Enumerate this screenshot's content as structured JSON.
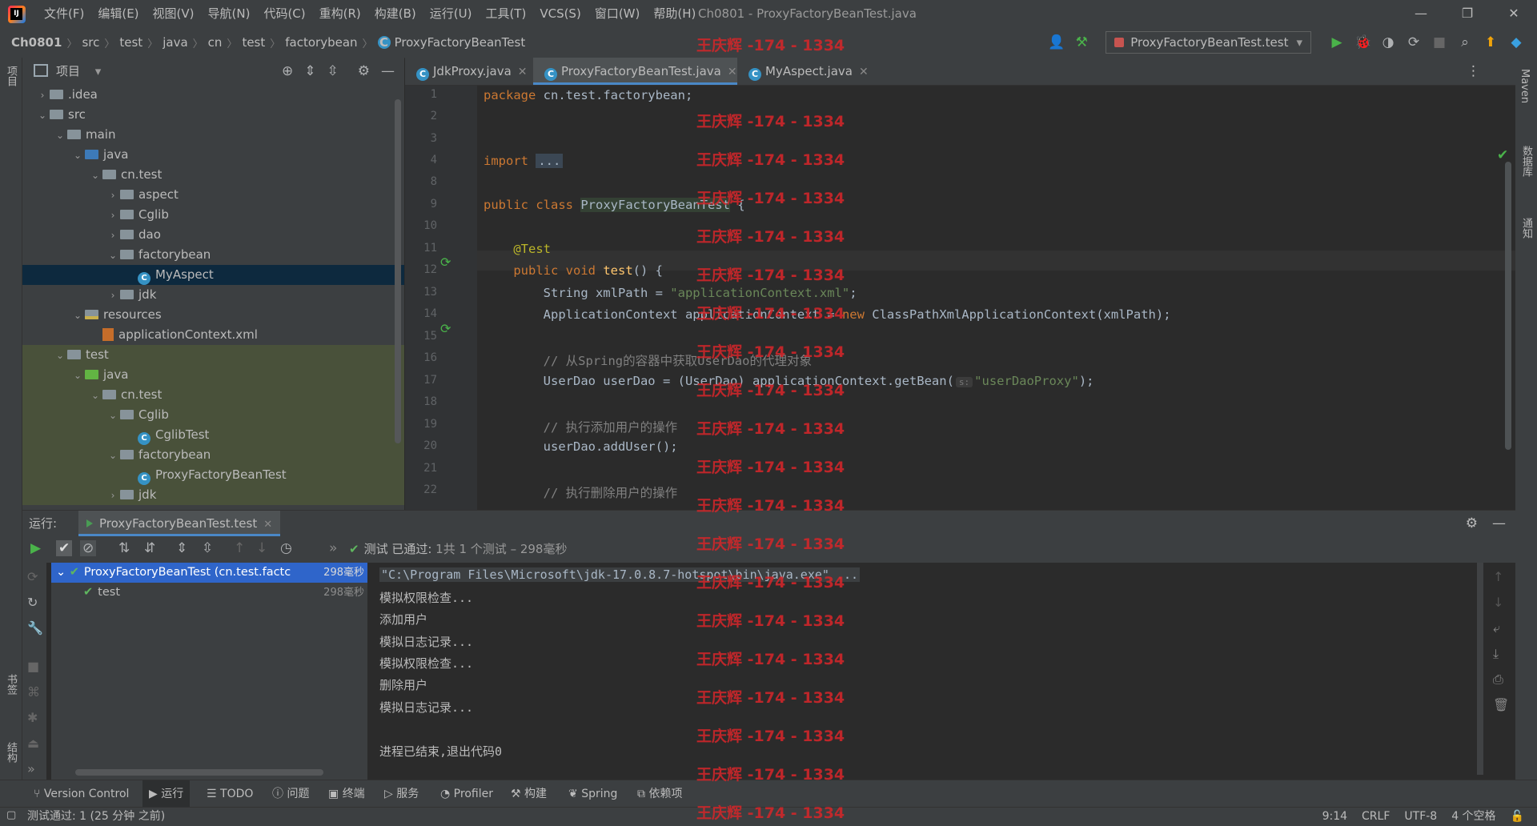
{
  "menubar": {
    "items": [
      "文件(F)",
      "编辑(E)",
      "视图(V)",
      "导航(N)",
      "代码(C)",
      "重构(R)",
      "构建(B)",
      "运行(U)",
      "工具(T)",
      "VCS(S)",
      "窗口(W)",
      "帮助(H)"
    ],
    "window_title": "Ch0801 - ProxyFactoryBeanTest.java"
  },
  "navbar": {
    "crumbs": [
      "Ch0801",
      "src",
      "test",
      "java",
      "cn",
      "test",
      "factorybean",
      "ProxyFactoryBeanTest"
    ],
    "run_config": "ProxyFactoryBeanTest.test"
  },
  "left_strip": {
    "project": "项目",
    "bookmarks": "书签",
    "structure": "结构"
  },
  "right_strip": {
    "maven": "Maven",
    "database": "数据库",
    "notifications": "通知"
  },
  "project": {
    "title": "项目",
    "tree": [
      {
        "label": ".idea",
        "depth": 0,
        "arrow": "right",
        "icon": "folder"
      },
      {
        "label": "src",
        "depth": 0,
        "arrow": "down",
        "icon": "folder"
      },
      {
        "label": "main",
        "depth": 1,
        "arrow": "down",
        "icon": "folder"
      },
      {
        "label": "java",
        "depth": 2,
        "arrow": "down",
        "icon": "folder-source"
      },
      {
        "label": "cn.test",
        "depth": 3,
        "arrow": "down",
        "icon": "package"
      },
      {
        "label": "aspect",
        "depth": 4,
        "arrow": "right",
        "icon": "package"
      },
      {
        "label": "Cglib",
        "depth": 4,
        "arrow": "right",
        "icon": "package"
      },
      {
        "label": "dao",
        "depth": 4,
        "arrow": "right",
        "icon": "package"
      },
      {
        "label": "factorybean",
        "depth": 4,
        "arrow": "down",
        "icon": "package"
      },
      {
        "label": "MyAspect",
        "depth": 5,
        "arrow": "",
        "icon": "class",
        "selected": true
      },
      {
        "label": "jdk",
        "depth": 4,
        "arrow": "right",
        "icon": "package"
      },
      {
        "label": "resources",
        "depth": 2,
        "arrow": "down",
        "icon": "folder-resources"
      },
      {
        "label": "applicationContext.xml",
        "depth": 3,
        "arrow": "",
        "icon": "xml"
      },
      {
        "label": "test",
        "depth": 1,
        "arrow": "down",
        "icon": "folder",
        "test": true
      },
      {
        "label": "java",
        "depth": 2,
        "arrow": "down",
        "icon": "folder-test",
        "test": true
      },
      {
        "label": "cn.test",
        "depth": 3,
        "arrow": "down",
        "icon": "package",
        "test": true
      },
      {
        "label": "Cglib",
        "depth": 4,
        "arrow": "down",
        "icon": "package",
        "test": true
      },
      {
        "label": "CglibTest",
        "depth": 5,
        "arrow": "",
        "icon": "class",
        "test": true
      },
      {
        "label": "factorybean",
        "depth": 4,
        "arrow": "down",
        "icon": "package",
        "test": true
      },
      {
        "label": "ProxyFactoryBeanTest",
        "depth": 5,
        "arrow": "",
        "icon": "class",
        "test": true
      },
      {
        "label": "jdk",
        "depth": 4,
        "arrow": "right",
        "icon": "package",
        "test": true
      }
    ]
  },
  "editor": {
    "tabs": [
      {
        "label": "JdkProxy.java",
        "active": false
      },
      {
        "label": "ProxyFactoryBeanTest.java",
        "active": true
      },
      {
        "label": "MyAspect.java",
        "active": false
      }
    ],
    "line_numbers": [
      "1",
      "2",
      "3",
      "4",
      "8",
      "9",
      "10",
      "11",
      "12",
      "13",
      "14",
      "15",
      "16",
      "17",
      "18",
      "19",
      "20",
      "21",
      "22"
    ],
    "code": {
      "l1_kw": "package",
      "l1_rest": " cn.test.factorybean;",
      "l4_kw": "import",
      "l4_fold": "...",
      "l9_kw": "public class",
      "l9_name": "ProxyFactoryBeanTest",
      "l9_rest": " {",
      "l11_ann": "@Test",
      "l12_kw": "public void",
      "l12_fn": "test",
      "l12_rest": "() {",
      "l13_a": "String xmlPath = ",
      "l13_str": "\"applicationContext.xml\"",
      "l13_b": ";",
      "l14_a": "ApplicationContext applicationContext = ",
      "l14_kw": "new",
      "l14_b": " ClassPathXmlApplicationContext(xmlPath);",
      "l16_cmt": "// 从Spring的容器中获取UserDao的代理对象",
      "l17_a": "UserDao userDao = (UserDao) applicationContext.getBean(",
      "l17_hint": "s:",
      "l17_str": "\"userDaoProxy\"",
      "l17_b": ");",
      "l19_cmt": "// 执行添加用户的操作",
      "l20": "userDao.addUser();",
      "l22_cmt": "// 执行删除用户的操作"
    }
  },
  "run": {
    "label": "运行:",
    "tab": "ProxyFactoryBeanTest.test",
    "status_bold": "测试 已通过:",
    "status_rest": " 1共 1 个测试 – 298毫秒",
    "tree": [
      {
        "label": "ProxyFactoryBeanTest (cn.test.factc",
        "time": "298毫秒",
        "selected": true
      },
      {
        "label": "test",
        "time": "298毫秒",
        "selected": false
      }
    ],
    "console": [
      "\"C:\\Program Files\\Microsoft\\jdk-17.0.8.7-hotspot\\bin\\java.exe\" ...",
      "模拟权限检查...",
      "添加用户",
      "模拟日志记录...",
      "模拟权限检查...",
      "删除用户",
      "模拟日志记录...",
      "",
      "进程已结束,退出代码0"
    ]
  },
  "bottom_tabs": [
    "Version Control",
    "运行",
    "TODO",
    "问题",
    "终端",
    "服务",
    "Profiler",
    "构建",
    "Spring",
    "依赖项"
  ],
  "statusbar": {
    "left": "测试通过: 1 (25 分钟 之前)",
    "position": "9:14",
    "line_sep": "CRLF",
    "encoding": "UTF-8",
    "indent": "4 个空格"
  },
  "watermark": "王庆辉 -174 - 1334",
  "colors": {
    "accent": "#4a88c7",
    "watermark": "#d3262a",
    "pass_green": "#5fb65f",
    "selection": "#2f65ca"
  }
}
